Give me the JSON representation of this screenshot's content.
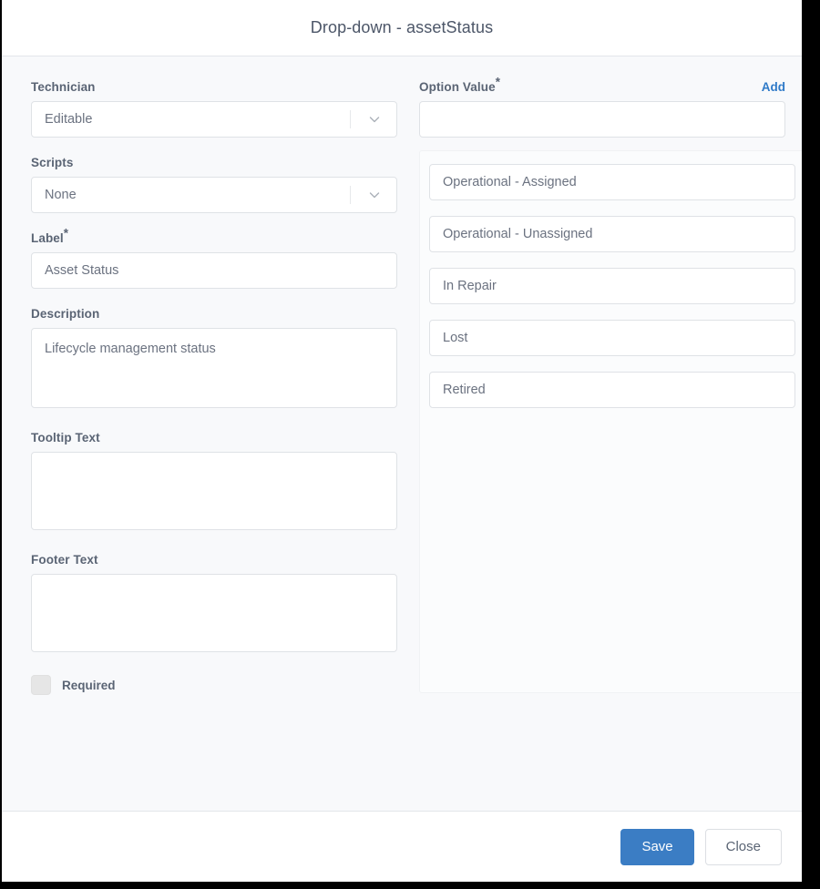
{
  "dialog": {
    "title": "Drop-down - assetStatus"
  },
  "left_panel": {
    "technician": {
      "label": "Technician",
      "value": "Editable",
      "icon": "chevron-down-icon"
    },
    "scripts": {
      "label": "Scripts",
      "value": "None",
      "icon": "chevron-down-icon"
    },
    "field_label": {
      "label": "Label",
      "required_marker": "*",
      "value": "Asset Status",
      "placeholder": ""
    },
    "description": {
      "label": "Description",
      "value": "Lifecycle management status",
      "placeholder": ""
    },
    "tooltip_text": {
      "label": "Tooltip Text",
      "value": "",
      "placeholder": ""
    },
    "footer_text": {
      "label": "Footer Text",
      "value": "",
      "placeholder": ""
    },
    "required_checkbox": {
      "label": "Required",
      "checked": false
    }
  },
  "right_panel": {
    "option_value": {
      "label": "Option Value",
      "required_marker": "*",
      "add_label": "Add",
      "new_option_value": "",
      "new_option_placeholder": ""
    },
    "options": [
      {
        "value": "Operational - Assigned"
      },
      {
        "value": "Operational - Unassigned"
      },
      {
        "value": "In Repair"
      },
      {
        "value": "Lost"
      },
      {
        "value": "Retired"
      }
    ]
  },
  "footer": {
    "save_label": "Save",
    "close_label": "Close"
  },
  "colors": {
    "accent": "#2f7ac8",
    "primary_button": "#3b7dc4",
    "label_text": "#5a6474",
    "input_text": "#6b7280",
    "panel_bg": "#f8f9fb",
    "border": "#dfe2e6"
  }
}
